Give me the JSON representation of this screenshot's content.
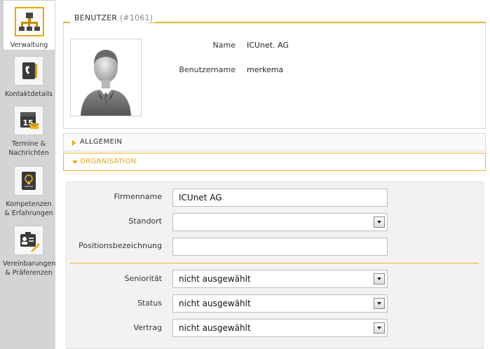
{
  "sidebar": {
    "items": [
      {
        "label": "Verwaltung",
        "icon": "org-chart-icon",
        "active": true
      },
      {
        "label": "Kontaktdetails",
        "icon": "contact-book-icon",
        "active": false
      },
      {
        "label": "Termine & Nachrichten",
        "icon": "calendar-icon",
        "active": false,
        "badge": "15"
      },
      {
        "label": "Kompetenzen & Erfahrungen",
        "icon": "skills-book-icon",
        "active": false
      },
      {
        "label": "Vereinbarungen & Präferenzen",
        "icon": "agreement-card-icon",
        "active": false
      }
    ]
  },
  "user_panel": {
    "legend": "BENUTZER",
    "user_id": "(#1061)",
    "avatar": "user-avatar-icon",
    "fields": [
      {
        "label": "Name",
        "value": "ICUnet. AG"
      },
      {
        "label": "Benutzername",
        "value": "merkema"
      }
    ]
  },
  "sections": {
    "allgemein": "ALLGEMEIN",
    "organisation": "ORGANISATION"
  },
  "form": {
    "firmenname": {
      "label": "Firmenname",
      "value": "ICUnet AG"
    },
    "standort": {
      "label": "Standort",
      "value": ""
    },
    "positionsbezeichnung": {
      "label": "Positionsbezeichnung",
      "value": ""
    },
    "senioritaet": {
      "label": "Seniorität",
      "value": "nicht ausgewählt"
    },
    "status": {
      "label": "Status",
      "value": "nicht ausgewählt"
    },
    "vertrag": {
      "label": "Vertrag",
      "value": "nicht ausgewählt"
    }
  },
  "colors": {
    "accent": "#f0a500",
    "accent_line": "#f0b323",
    "sidebar_bg": "#d4d4d4",
    "form_bg": "#f2f2f2"
  }
}
